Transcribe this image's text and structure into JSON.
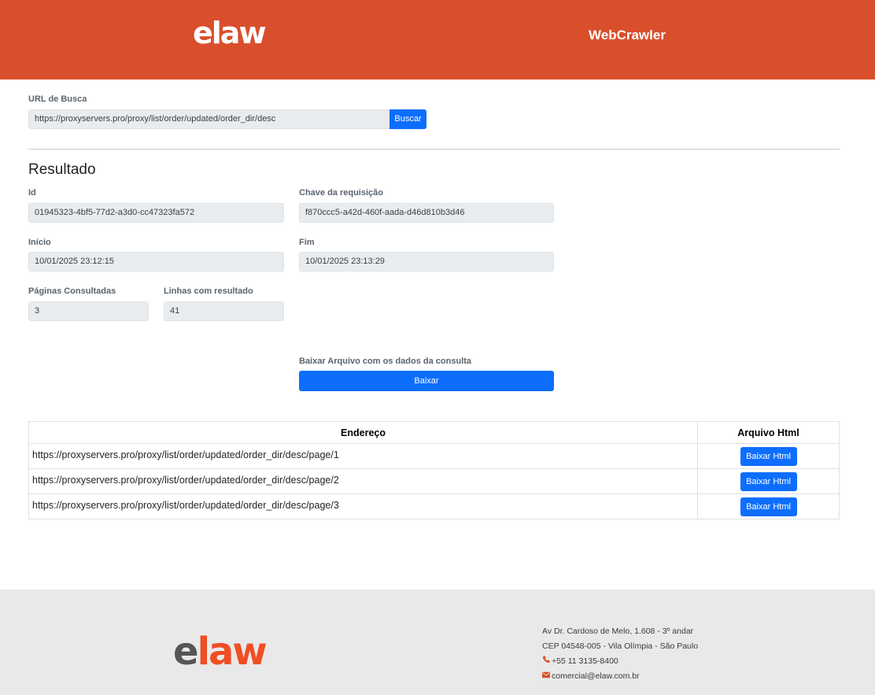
{
  "header": {
    "logo_text": "elaw",
    "title": "WebCrawler"
  },
  "search": {
    "label": "URL de Busca",
    "value": "https://proxyservers.pro/proxy/list/order/updated/order_dir/desc",
    "button_label": "Buscar"
  },
  "result": {
    "title": "Resultado",
    "id_label": "Id",
    "id_value": "01945323-4bf5-77d2-a3d0-cc47323fa572",
    "key_label": "Chave da requisição",
    "key_value": "f870ccc5-a42d-460f-aada-d46d810b3d46",
    "start_label": "Início",
    "start_value": "10/01/2025 23:12:15",
    "end_label": "Fim",
    "end_value": "10/01/2025 23:13:29",
    "pages_label": "Páginas Consultadas",
    "pages_value": "3",
    "lines_label": "Linhas com resultado",
    "lines_value": "41",
    "download_label": "Baixar Arquivo com os dados da consulta",
    "download_button": "Baixar"
  },
  "table": {
    "headers": [
      "Endereço",
      "Arquivo Html"
    ],
    "rows": [
      {
        "url": "https://proxyservers.pro/proxy/list/order/updated/order_dir/desc/page/1",
        "button": "Baixar Html"
      },
      {
        "url": "https://proxyservers.pro/proxy/list/order/updated/order_dir/desc/page/2",
        "button": "Baixar Html"
      },
      {
        "url": "https://proxyservers.pro/proxy/list/order/updated/order_dir/desc/page/3",
        "button": "Baixar Html"
      }
    ]
  },
  "footer": {
    "logo_e": "e",
    "logo_rest": "law",
    "address_line1": "Av Dr. Cardoso de Melo, 1.608 - 3º andar",
    "address_line2": "CEP 04548-005 - Vila Olímpia - São Paulo",
    "phone": "+55 11 3135-8400",
    "email": "comercial@elaw.com.br"
  },
  "icons": {
    "phone": "phone-icon",
    "email": "envelope-icon"
  },
  "colors": {
    "brand": "#d94f2c",
    "primary_button": "#0d6efd",
    "footer_bg": "#e9e9e9"
  }
}
